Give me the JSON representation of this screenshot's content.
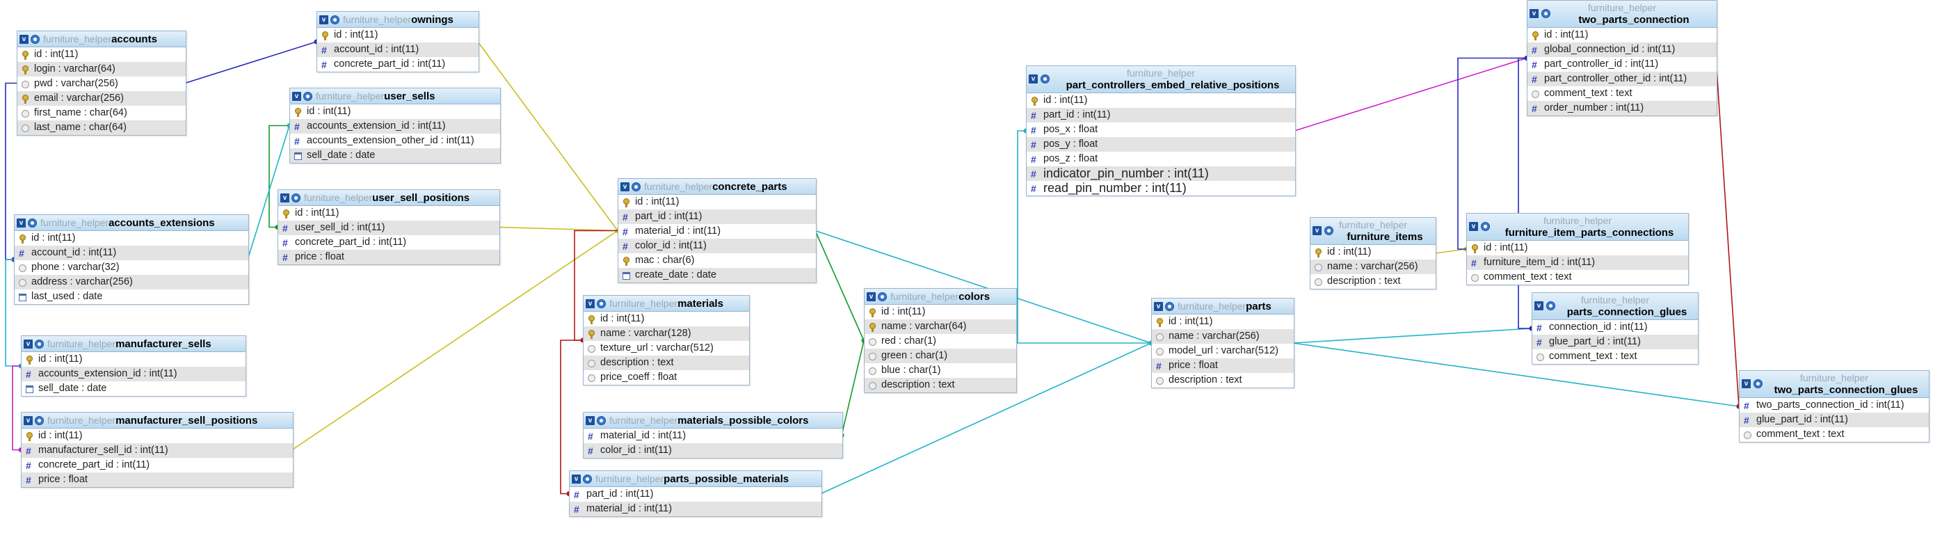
{
  "diagram": {
    "tables": [
      {
        "id": "accounts",
        "db": "furniture_helper",
        "name": "accounts",
        "fields": [
          {
            "text": "id : int(11)",
            "kind": "pk"
          },
          {
            "text": "login : varchar(64)",
            "kind": "pk"
          },
          {
            "text": "pwd : varchar(256)",
            "kind": "txt"
          },
          {
            "text": "email : varchar(256)",
            "kind": "pk"
          },
          {
            "text": "first_name : char(64)",
            "kind": "txt"
          },
          {
            "text": "last_name : char(64)",
            "kind": "txt"
          }
        ]
      },
      {
        "id": "ownings",
        "db": "furniture_helper",
        "name": "ownings",
        "fields": [
          {
            "text": "id : int(11)",
            "kind": "pk"
          },
          {
            "text": "account_id : int(11)",
            "kind": "num"
          },
          {
            "text": "concrete_part_id : int(11)",
            "kind": "num"
          }
        ]
      },
      {
        "id": "user_sells",
        "db": "furniture_helper",
        "name": "user_sells",
        "fields": [
          {
            "text": "id : int(11)",
            "kind": "pk"
          },
          {
            "text": "accounts_extension_id : int(11)",
            "kind": "num"
          },
          {
            "text": "accounts_extension_other_id : int(11)",
            "kind": "num"
          },
          {
            "text": "sell_date : date",
            "kind": "date"
          }
        ]
      },
      {
        "id": "user_sell_positions",
        "db": "furniture_helper",
        "name": "user_sell_positions",
        "fields": [
          {
            "text": "id : int(11)",
            "kind": "pk"
          },
          {
            "text": "user_sell_id : int(11)",
            "kind": "num"
          },
          {
            "text": "concrete_part_id : int(11)",
            "kind": "num"
          },
          {
            "text": "price : float",
            "kind": "num"
          }
        ]
      },
      {
        "id": "accounts_extensions",
        "db": "furniture_helper",
        "name": "accounts_extensions",
        "fields": [
          {
            "text": "id : int(11)",
            "kind": "pk"
          },
          {
            "text": "account_id : int(11)",
            "kind": "num"
          },
          {
            "text": "phone : varchar(32)",
            "kind": "txt"
          },
          {
            "text": "address : varchar(256)",
            "kind": "txt"
          },
          {
            "text": "last_used : date",
            "kind": "date"
          }
        ]
      },
      {
        "id": "manufacturer_sells",
        "db": "furniture_helper",
        "name": "manufacturer_sells",
        "fields": [
          {
            "text": "id : int(11)",
            "kind": "pk"
          },
          {
            "text": "accounts_extension_id : int(11)",
            "kind": "num"
          },
          {
            "text": "sell_date : date",
            "kind": "date"
          }
        ]
      },
      {
        "id": "manufacturer_sell_positions",
        "db": "furniture_helper",
        "name": "manufacturer_sell_positions",
        "fields": [
          {
            "text": "id : int(11)",
            "kind": "pk"
          },
          {
            "text": "manufacturer_sell_id : int(11)",
            "kind": "num"
          },
          {
            "text": "concrete_part_id : int(11)",
            "kind": "num"
          },
          {
            "text": "price : float",
            "kind": "num"
          }
        ]
      },
      {
        "id": "concrete_parts",
        "db": "furniture_helper",
        "name": "concrete_parts",
        "fields": [
          {
            "text": "id : int(11)",
            "kind": "pk"
          },
          {
            "text": "part_id : int(11)",
            "kind": "num"
          },
          {
            "text": "material_id : int(11)",
            "kind": "num"
          },
          {
            "text": "color_id : int(11)",
            "kind": "num"
          },
          {
            "text": "mac : char(6)",
            "kind": "pk"
          },
          {
            "text": "create_date : date",
            "kind": "date"
          }
        ]
      },
      {
        "id": "materials",
        "db": "furniture_helper",
        "name": "materials",
        "fields": [
          {
            "text": "id : int(11)",
            "kind": "pk"
          },
          {
            "text": "name : varchar(128)",
            "kind": "pk"
          },
          {
            "text": "texture_url : varchar(512)",
            "kind": "txt"
          },
          {
            "text": "description : text",
            "kind": "txt"
          },
          {
            "text": "price_coeff : float",
            "kind": "txt"
          }
        ]
      },
      {
        "id": "materials_possible_colors",
        "db": "furniture_helper",
        "name": "materials_possible_colors",
        "fields": [
          {
            "text": "material_id : int(11)",
            "kind": "num"
          },
          {
            "text": "color_id : int(11)",
            "kind": "num"
          }
        ]
      },
      {
        "id": "parts_possible_materials",
        "db": "furniture_helper",
        "name": "parts_possible_materials",
        "fields": [
          {
            "text": "part_id : int(11)",
            "kind": "num"
          },
          {
            "text": "material_id : int(11)",
            "kind": "num"
          }
        ]
      },
      {
        "id": "colors",
        "db": "furniture_helper",
        "name": "colors",
        "fields": [
          {
            "text": "id : int(11)",
            "kind": "pk"
          },
          {
            "text": "name : varchar(64)",
            "kind": "pk"
          },
          {
            "text": "red : char(1)",
            "kind": "txt"
          },
          {
            "text": "green : char(1)",
            "kind": "txt"
          },
          {
            "text": "blue : char(1)",
            "kind": "txt"
          },
          {
            "text": "description : text",
            "kind": "txt"
          }
        ]
      },
      {
        "id": "part_controllers",
        "db": "furniture_helper",
        "name": "part_controllers_embed_relative_positions",
        "fields": [
          {
            "text": "id : int(11)",
            "kind": "pk"
          },
          {
            "text": "part_id : int(11)",
            "kind": "num"
          },
          {
            "text": "pos_x : float",
            "kind": "num"
          },
          {
            "text": "pos_y : float",
            "kind": "num"
          },
          {
            "text": "pos_z : float",
            "kind": "num"
          },
          {
            "text": "indicator_pin_number : int(11)",
            "kind": "num",
            "big": true
          },
          {
            "text": "read_pin_number : int(11)",
            "kind": "num",
            "big": true
          }
        ]
      },
      {
        "id": "parts",
        "db": "furniture_helper",
        "name": "parts",
        "fields": [
          {
            "text": "id : int(11)",
            "kind": "pk"
          },
          {
            "text": "name : varchar(256)",
            "kind": "txt"
          },
          {
            "text": "model_url : varchar(512)",
            "kind": "txt"
          },
          {
            "text": "price : float",
            "kind": "num"
          },
          {
            "text": "description : text",
            "kind": "txt"
          }
        ]
      },
      {
        "id": "furniture_items",
        "db": "furniture_helper",
        "name": "furniture_items",
        "fields": [
          {
            "text": "id : int(11)",
            "kind": "pk"
          },
          {
            "text": "name : varchar(256)",
            "kind": "txt"
          },
          {
            "text": "description : text",
            "kind": "txt"
          }
        ]
      },
      {
        "id": "furniture_item_parts_connections",
        "db": "furniture_helper",
        "name": "furniture_item_parts_connections",
        "fields": [
          {
            "text": "id : int(11)",
            "kind": "pk"
          },
          {
            "text": "furniture_item_id : int(11)",
            "kind": "num"
          },
          {
            "text": "comment_text : text",
            "kind": "txt"
          }
        ]
      },
      {
        "id": "two_parts_connection",
        "db": "furniture_helper",
        "name": "two_parts_connection",
        "fields": [
          {
            "text": "id : int(11)",
            "kind": "pk"
          },
          {
            "text": "global_connection_id : int(11)",
            "kind": "num"
          },
          {
            "text": "part_controller_id : int(11)",
            "kind": "num"
          },
          {
            "text": "part_controller_other_id : int(11)",
            "kind": "num"
          },
          {
            "text": "comment_text : text",
            "kind": "txt"
          },
          {
            "text": "order_number : int(11)",
            "kind": "num"
          }
        ]
      },
      {
        "id": "parts_connection_glues",
        "db": "furniture_helper",
        "name": "parts_connection_glues",
        "fields": [
          {
            "text": "connection_id : int(11)",
            "kind": "num"
          },
          {
            "text": "glue_part_id : int(11)",
            "kind": "num"
          },
          {
            "text": "comment_text : text",
            "kind": "txt"
          }
        ]
      },
      {
        "id": "two_parts_connection_glues",
        "db": "furniture_helper",
        "name": "two_parts_connection_glues",
        "fields": [
          {
            "text": "two_parts_connection_id : int(11)",
            "kind": "num"
          },
          {
            "text": "glue_part_id : int(11)",
            "kind": "num"
          },
          {
            "text": "comment_text : text",
            "kind": "txt"
          }
        ]
      }
    ],
    "links": [
      {
        "from": "accounts",
        "to": "ownings",
        "color": "#2a2abf"
      },
      {
        "from": "accounts",
        "to": "accounts_extensions",
        "color": "#2a2abf"
      },
      {
        "from": "ownings",
        "to": "concrete_parts",
        "color": "#c8c020"
      },
      {
        "from": "user_sells",
        "to": "user_sell_positions",
        "color": "#129a2a"
      },
      {
        "from": "accounts_extensions",
        "to": "user_sells",
        "color": "#20b4c8"
      },
      {
        "from": "accounts_extensions",
        "to": "manufacturer_sells",
        "color": "#20b4c8"
      },
      {
        "from": "user_sell_positions",
        "to": "concrete_parts",
        "color": "#c8c020"
      },
      {
        "from": "manufacturer_sells",
        "to": "manufacturer_sell_positions",
        "color": "#c020c0"
      },
      {
        "from": "manufacturer_sell_positions",
        "to": "concrete_parts",
        "color": "#c8c020"
      },
      {
        "from": "concrete_parts",
        "to": "materials",
        "color": "#b01818"
      },
      {
        "from": "concrete_parts",
        "to": "colors",
        "color": "#129a2a"
      },
      {
        "from": "concrete_parts",
        "to": "parts",
        "color": "#20b4c8"
      },
      {
        "from": "materials",
        "to": "parts_possible_materials",
        "color": "#b01818"
      },
      {
        "from": "colors",
        "to": "materials_possible_colors",
        "color": "#129a2a"
      },
      {
        "from": "parts_possible_materials",
        "to": "parts",
        "color": "#20b4c8"
      },
      {
        "from": "parts",
        "to": "part_controllers",
        "color": "#20b4c8"
      },
      {
        "from": "parts",
        "to": "parts_connection_glues",
        "color": "#20b4c8"
      },
      {
        "from": "parts",
        "to": "two_parts_connection_glues",
        "color": "#20b4c8"
      },
      {
        "from": "part_controllers",
        "to": "two_parts_connection",
        "color": "#d020d0"
      },
      {
        "from": "furniture_items",
        "to": "furniture_item_parts_connections",
        "color": "#c8c020"
      },
      {
        "from": "furniture_item_parts_connections",
        "to": "two_parts_connection",
        "color": "#2a2abf"
      },
      {
        "from": "two_parts_connection",
        "to": "parts_connection_glues",
        "color": "#2a2abf"
      },
      {
        "from": "two_parts_connection",
        "to": "two_parts_connection_glues",
        "color": "#b01818"
      }
    ]
  }
}
